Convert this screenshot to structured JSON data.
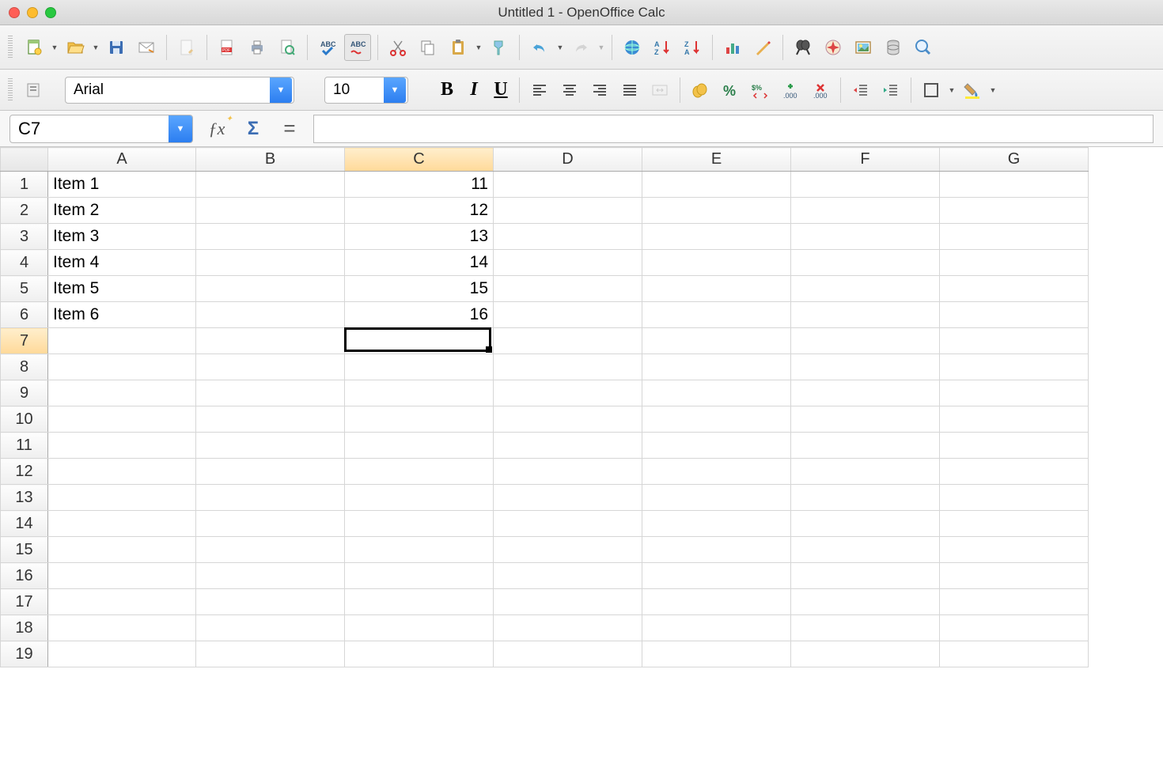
{
  "window": {
    "title": "Untitled 1 - OpenOffice Calc"
  },
  "format": {
    "font": "Arial",
    "size": "10"
  },
  "formulabar": {
    "cellref": "C7",
    "formula": ""
  },
  "columns": [
    "A",
    "B",
    "C",
    "D",
    "E",
    "F",
    "G"
  ],
  "rows": [
    1,
    2,
    3,
    4,
    5,
    6,
    7,
    8,
    9,
    10,
    11,
    12,
    13,
    14,
    15,
    16,
    17,
    18,
    19
  ],
  "selected": {
    "row": 7,
    "col": "C"
  },
  "cells": {
    "A1": "Item 1",
    "A2": "Item 2",
    "A3": "Item 3",
    "A4": "Item 4",
    "A5": "Item 5",
    "A6": "Item 6",
    "C1": "11",
    "C2": "12",
    "C3": "13",
    "C4": "14",
    "C5": "15",
    "C6": "16"
  },
  "icons": {
    "bold": "B",
    "italic": "I",
    "underline": "U",
    "equals": "=",
    "sigma": "Σ",
    "fx": "ƒx"
  }
}
